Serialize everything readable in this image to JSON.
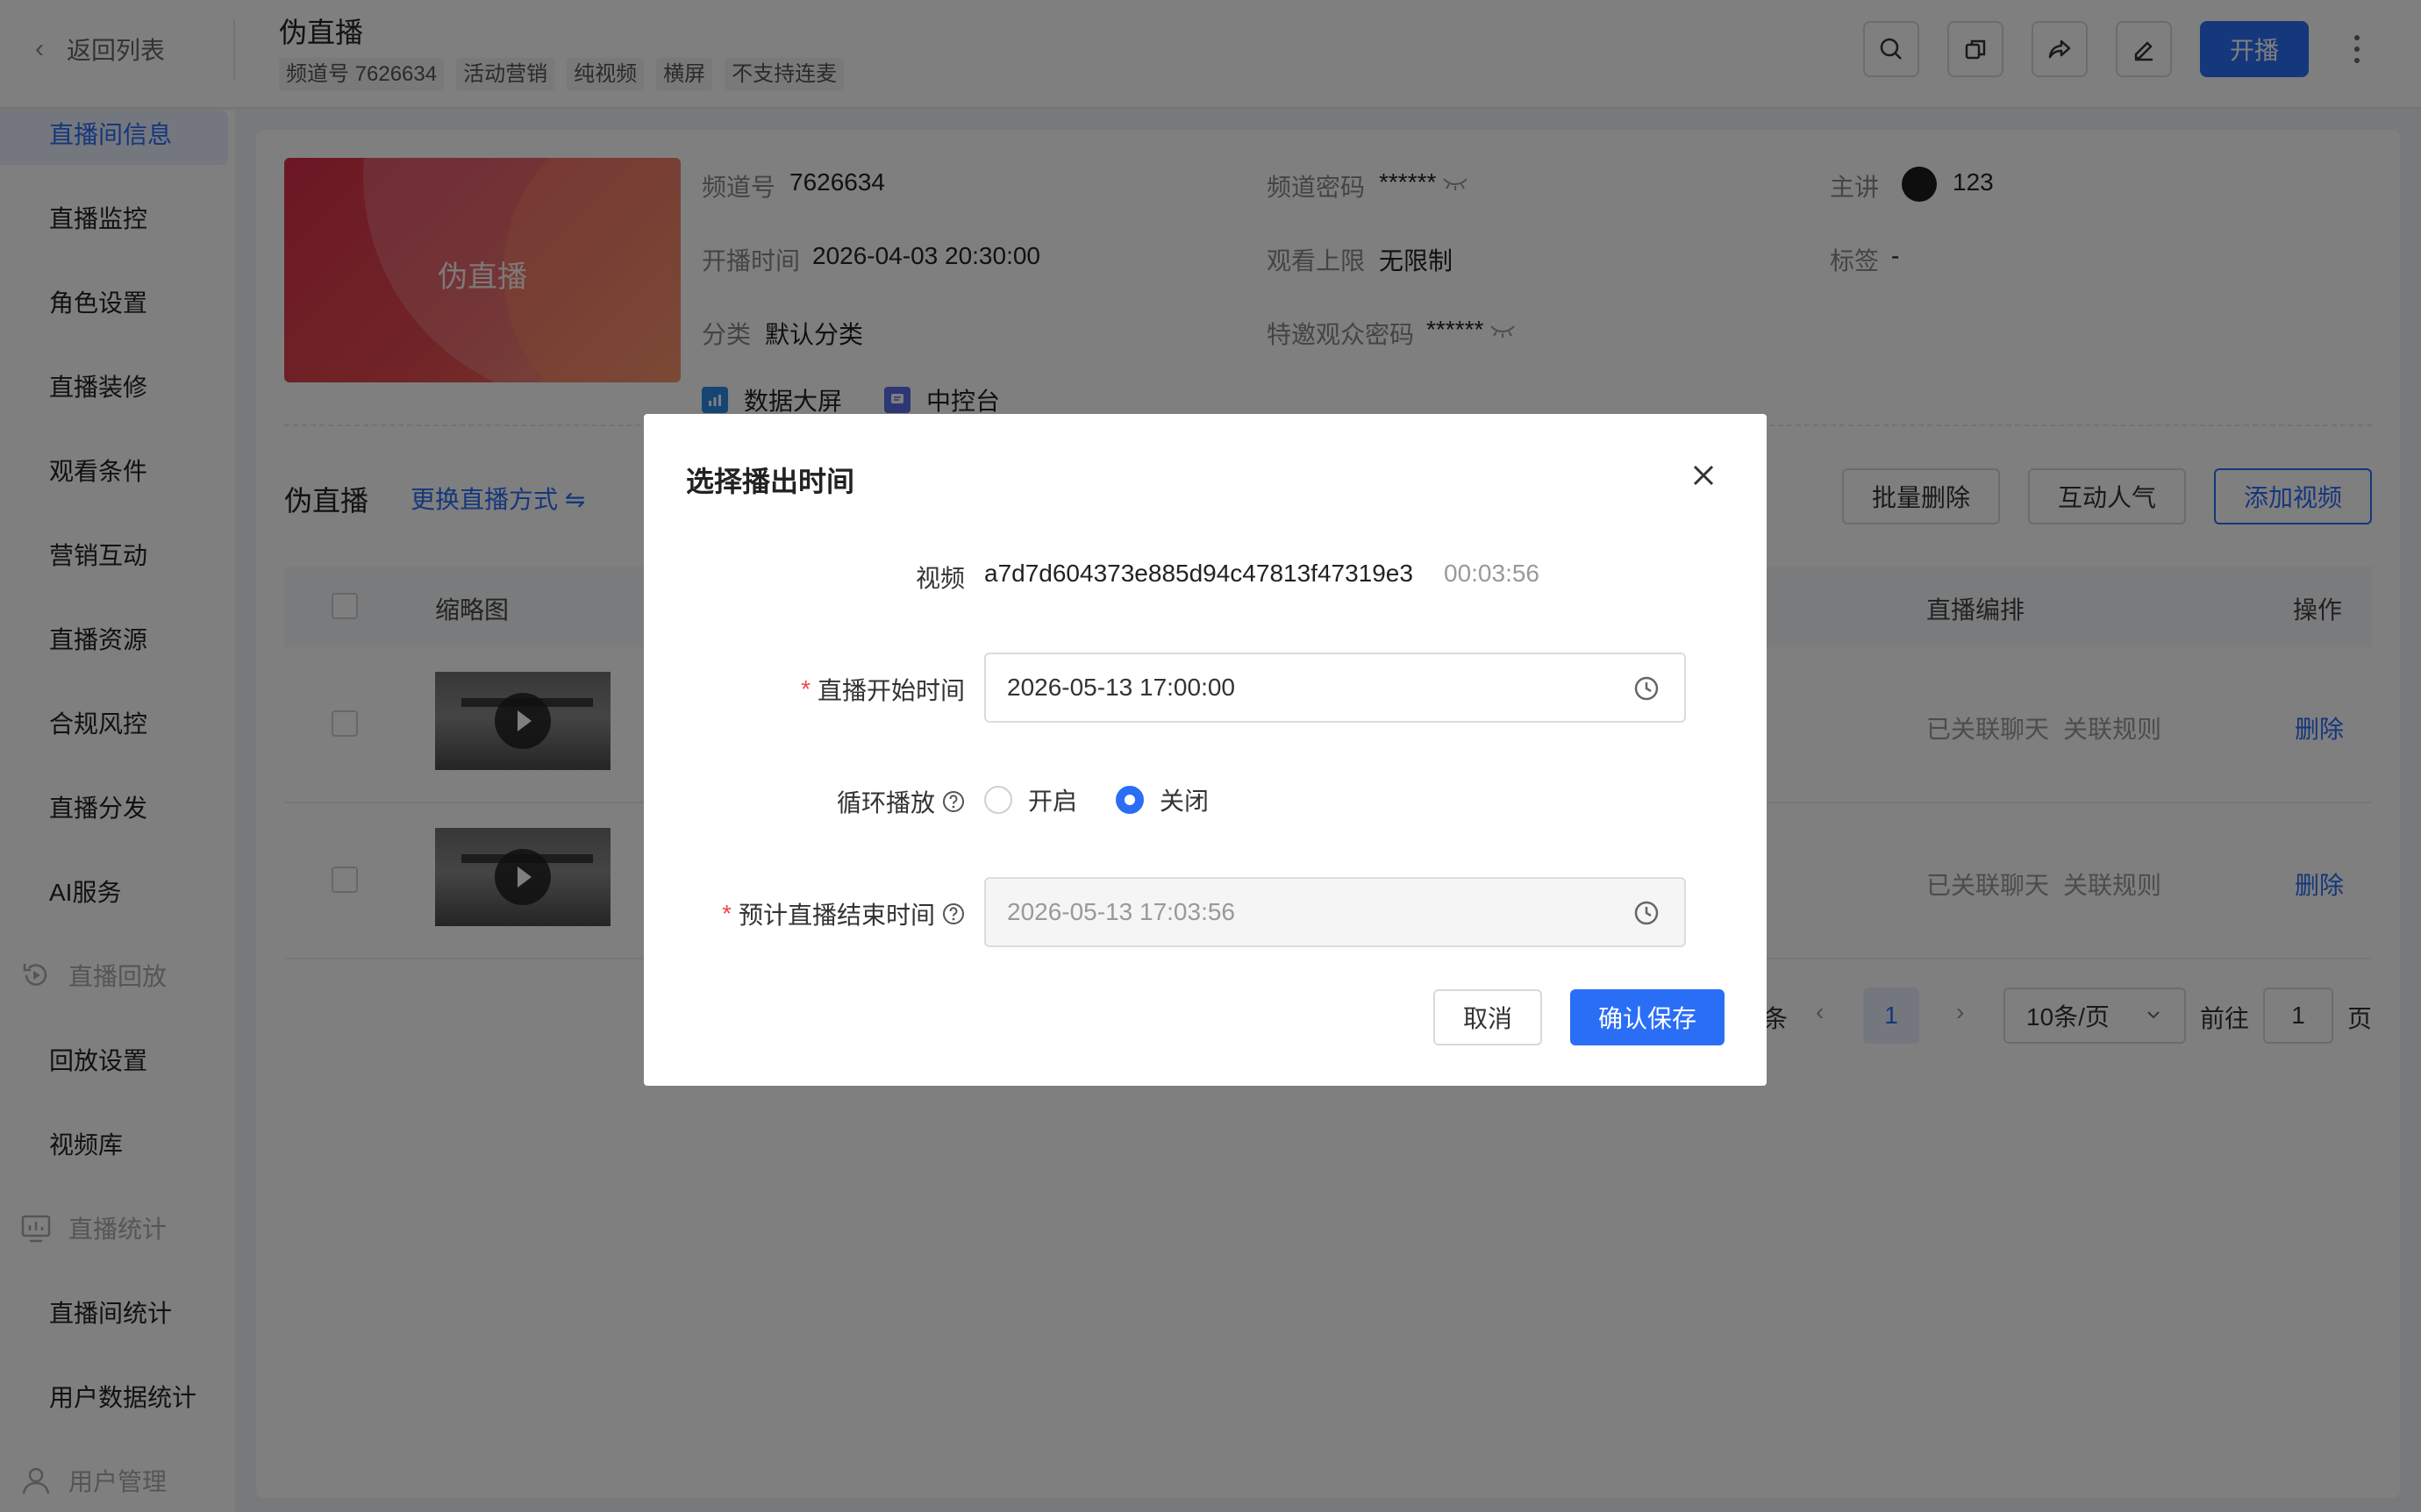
{
  "header": {
    "back_label": "返回列表",
    "title": "伪直播",
    "tags": [
      "频道号 7626634",
      "活动营销",
      "纯视频",
      "横屏",
      "不支持连麦"
    ],
    "start_label": "开播"
  },
  "sidebar": {
    "active_item": "直播间信息",
    "items": [
      "直播监控",
      "角色设置",
      "直播装修",
      "观看条件",
      "营销互动",
      "直播资源",
      "合规风控",
      "直播分发",
      "AI服务"
    ],
    "group_playback": "直播回放",
    "playback_items": [
      "回放设置",
      "视频库"
    ],
    "group_stats": "直播统计",
    "stats_items": [
      "直播间统计",
      "用户数据统计"
    ],
    "group_users": "用户管理"
  },
  "info": {
    "cover_title": "伪直播",
    "channel_label": "频道号",
    "channel_value": "7626634",
    "password_label": "频道密码",
    "password_value": "******",
    "host_label": "主讲",
    "host_value": "123",
    "start_time_label": "开播时间",
    "start_time_value": "2026-04-03 20:30:00",
    "limit_label": "观看上限",
    "limit_value": "无限制",
    "tag_label": "标签",
    "tag_value": "-",
    "category_label": "分类",
    "category_value": "默认分类",
    "invite_pwd_label": "特邀观众密码",
    "invite_pwd_value": "******",
    "dashboard_label": "数据大屏",
    "console_label": "中控台"
  },
  "section": {
    "title": "伪直播",
    "switch_label": "更换直播方式 ⇋",
    "batch_delete": "批量删除",
    "interact_popularity": "互动人气",
    "add_video": "添加视频"
  },
  "table": {
    "col_thumbnail": "缩略图",
    "col_schedule": "直播编排",
    "col_action": "操作",
    "rows": [
      {
        "chat": "已关联聊天",
        "rule": "关联规则",
        "action": "删除"
      },
      {
        "chat": "已关联聊天",
        "rule": "关联规则",
        "action": "删除"
      }
    ]
  },
  "pager": {
    "items_suffix": "条",
    "prev": "‹",
    "next": "›",
    "current": "1",
    "page_size": "10条/页",
    "goto_label": "前往",
    "goto_value": "1",
    "page_suffix": "页"
  },
  "dialog": {
    "title": "选择播出时间",
    "video_label": "视频",
    "video_name": "a7d7d604373e885d94c47813f47319e3",
    "video_duration": "00:03:56",
    "start_label": "直播开始时间",
    "start_value": "2026-05-13 17:00:00",
    "loop_label": "循环播放",
    "loop_on": "开启",
    "loop_off": "关闭",
    "loop_selected": "关闭",
    "end_label": "预计直播结束时间",
    "end_value": "2026-05-13 17:03:56",
    "cancel_label": "取消",
    "confirm_label": "确认保存",
    "required_mark": "*"
  },
  "colors": {
    "primary": "#2b6ef6",
    "required": "#f04848",
    "overlay": "rgba(0,0,0,0.5)"
  }
}
